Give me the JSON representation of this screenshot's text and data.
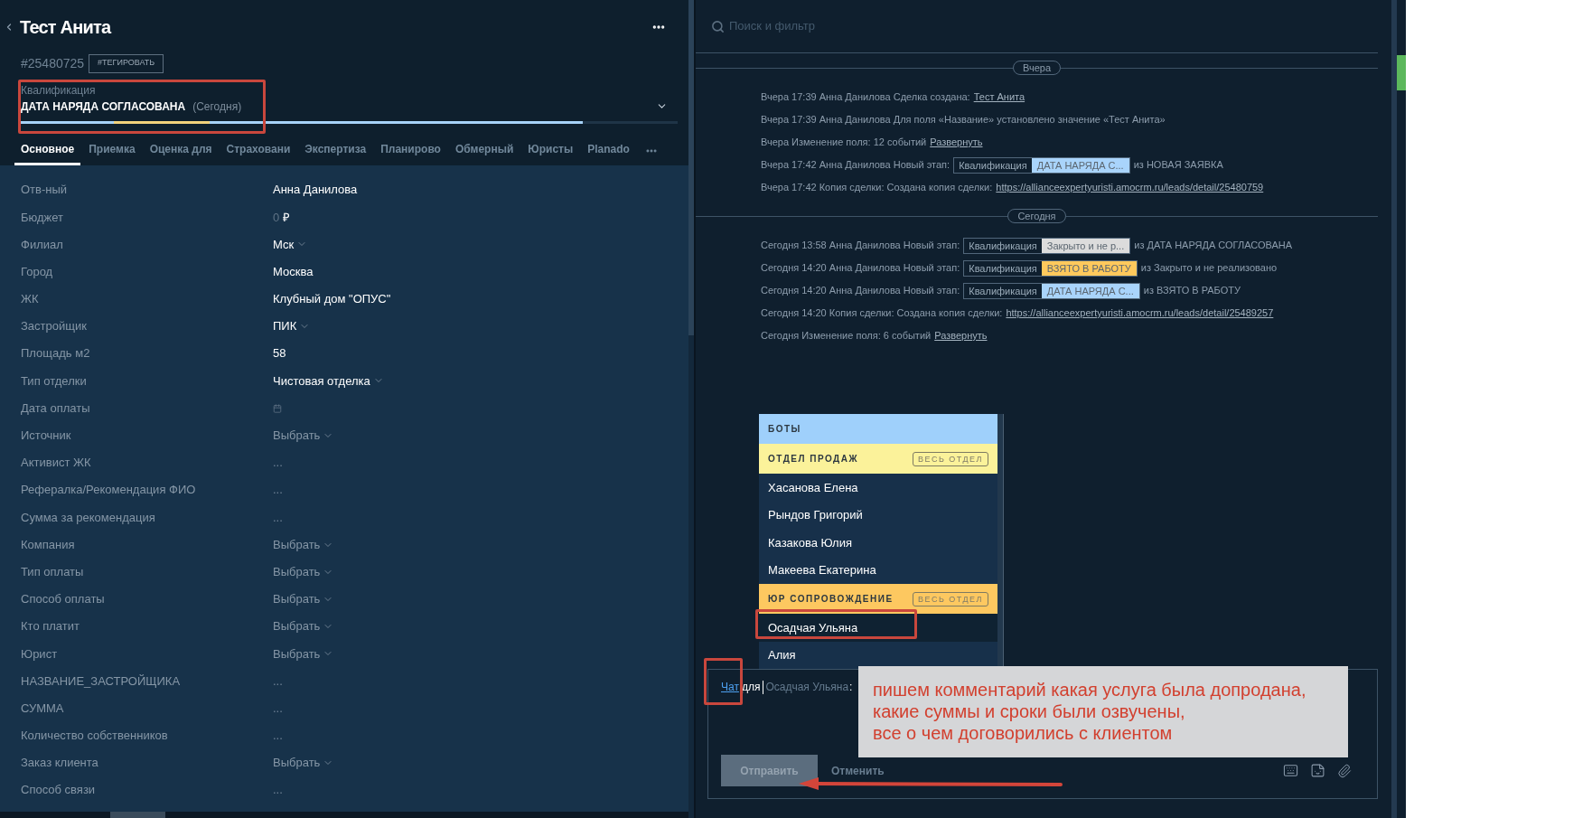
{
  "header": {
    "title": "Тест Анита",
    "deal_id": "#25480725",
    "tag_button": "#ТЕГИРОВАТЬ",
    "pipeline": "Квалификация",
    "stage": "ДАТА НАРЯДА СОГЛАСОВАНА",
    "stage_since": "(Сегодня)",
    "progress": [
      {
        "color": "#a6d2f7",
        "level": 0.142
      },
      {
        "color": "#f2d27c",
        "level": 0.288
      },
      {
        "color": "#a6d2f7",
        "level": 0.856
      }
    ]
  },
  "tabs": [
    {
      "label": "Основное",
      "selected": true
    },
    {
      "label": "Приемка",
      "selected": false
    },
    {
      "label": "Оценка для",
      "selected": false
    },
    {
      "label": "Страховани",
      "selected": false
    },
    {
      "label": "Экспертиза",
      "selected": false
    },
    {
      "label": "Планирово",
      "selected": false
    },
    {
      "label": "Обмерный",
      "selected": false
    },
    {
      "label": "Юристы",
      "selected": false
    },
    {
      "label": "Planado",
      "selected": false
    }
  ],
  "fields": [
    {
      "label": "Отв-ный",
      "kind": "text",
      "value": "Анна Данилова"
    },
    {
      "label": "Бюджет",
      "kind": "money",
      "placeholder": "0",
      "currency": "₽"
    },
    {
      "label": "Филиал",
      "kind": "select",
      "value": "Мск"
    },
    {
      "label": "Город",
      "kind": "text",
      "value": "Москва"
    },
    {
      "label": "ЖК",
      "kind": "text",
      "value": "Клубный дом \"ОПУС\""
    },
    {
      "label": "Застройщик",
      "kind": "select",
      "value": "ПИК"
    },
    {
      "label": "Площадь м2",
      "kind": "text",
      "value": "58"
    },
    {
      "label": "Тип отделки",
      "kind": "select",
      "value": "Чистовая отделка"
    },
    {
      "label": "Дата оплаты",
      "kind": "date"
    },
    {
      "label": "Источник",
      "kind": "select",
      "placeholder": "Выбрать"
    },
    {
      "label": "Активист ЖК",
      "kind": "text",
      "placeholder": "..."
    },
    {
      "label": "Рефералка/Рекомендация ФИО",
      "kind": "text",
      "placeholder": "..."
    },
    {
      "label": "Сумма за рекомендация",
      "kind": "text",
      "placeholder": "..."
    },
    {
      "label": "Компания",
      "kind": "select",
      "placeholder": "Выбрать"
    },
    {
      "label": "Тип оплаты",
      "kind": "select",
      "placeholder": "Выбрать"
    },
    {
      "label": "Способ оплаты",
      "kind": "select",
      "placeholder": "Выбрать"
    },
    {
      "label": "Кто платит",
      "kind": "select",
      "placeholder": "Выбрать"
    },
    {
      "label": "Юрист",
      "kind": "select",
      "placeholder": "Выбрать"
    },
    {
      "label": "НАЗВАНИЕ_ЗАСТРОЙЩИКА",
      "kind": "text",
      "placeholder": "..."
    },
    {
      "label": "СУММА",
      "kind": "text",
      "placeholder": "..."
    },
    {
      "label": "Количество собственников",
      "kind": "text",
      "placeholder": "..."
    },
    {
      "label": "Заказ клиента",
      "kind": "select",
      "placeholder": "Выбрать"
    },
    {
      "label": "Способ связи",
      "kind": "text",
      "placeholder": "..."
    }
  ],
  "search": {
    "placeholder": "Поиск и фильтр"
  },
  "timeline": [
    {
      "date": "Вчера",
      "events": [
        {
          "parts": [
            {
              "kind": "text",
              "text": "Вчера 17:39 Анна Данилова Сделка создана:"
            },
            {
              "kind": "link",
              "text": "Тест Анита"
            }
          ]
        },
        {
          "parts": [
            {
              "kind": "text",
              "text": "Вчера 17:39 Анна Данилова Для поля «Название» установлено значение «Тест Анита»"
            }
          ]
        },
        {
          "parts": [
            {
              "kind": "text",
              "text": "Вчера Изменение поля: 12 событий"
            },
            {
              "kind": "link",
              "text": "Развернуть"
            }
          ]
        },
        {
          "parts": [
            {
              "kind": "text",
              "text": "Вчера 17:42 Анна Данилова Новый этап:"
            },
            {
              "kind": "stage",
              "pipeline": "Квалификация",
              "status": "ДАТА НАРЯДА С...",
              "color": "#a9d4fb"
            },
            {
              "kind": "text",
              "text": "из НОВАЯ ЗАЯВКА"
            }
          ]
        },
        {
          "parts": [
            {
              "kind": "text",
              "text": "Вчера 17:42 Копия сделки: Создана копия сделки:"
            },
            {
              "kind": "link",
              "text": "https://allianceexpertyuristi.amocrm.ru/leads/detail/25480759"
            }
          ]
        }
      ]
    },
    {
      "date": "Сегодня",
      "events": [
        {
          "parts": [
            {
              "kind": "text",
              "text": "Сегодня 13:58 Анна Данилова Новый этап:"
            },
            {
              "kind": "stage",
              "pipeline": "Квалификация",
              "status": "Закрыто и не р...",
              "color": "#dcdcdc"
            },
            {
              "kind": "text",
              "text": "из ДАТА НАРЯДА СОГЛАСОВАНА"
            }
          ]
        },
        {
          "parts": [
            {
              "kind": "text",
              "text": "Сегодня 14:20 Анна Данилова Новый этап:"
            },
            {
              "kind": "stage",
              "pipeline": "Квалификация",
              "status": "ВЗЯТО В РАБОТУ",
              "color": "#ffc95c"
            },
            {
              "kind": "text",
              "text": "из Закрыто и не реализовано"
            }
          ]
        },
        {
          "parts": [
            {
              "kind": "text",
              "text": "Сегодня 14:20 Анна Данилова Новый этап:"
            },
            {
              "kind": "stage",
              "pipeline": "Квалификация",
              "status": "ДАТА НАРЯДА С...",
              "color": "#a9d4fb"
            },
            {
              "kind": "text",
              "text": "из ВЗЯТО В РАБОТУ"
            }
          ]
        },
        {
          "parts": [
            {
              "kind": "text",
              "text": "Сегодня 14:20 Копия сделки: Создана копия сделки:"
            },
            {
              "kind": "link",
              "text": "https://allianceexpertyuristi.amocrm.ru/leads/detail/25489257"
            }
          ]
        },
        {
          "parts": [
            {
              "kind": "text",
              "text": "Сегодня Изменение поля: 6 событий"
            },
            {
              "kind": "link",
              "text": "Развернуть"
            }
          ]
        }
      ]
    }
  ],
  "mention_menu": {
    "groups": [
      {
        "name": "БОТЫ",
        "color": "#9fd0fb"
      },
      {
        "name": "ОТДЕЛ ПРОДАЖ",
        "color": "#fbf29a",
        "action": "ВЕСЬ ОТДЕЛ",
        "members": [
          {
            "name": "Хасанова Елена",
            "selected": false
          },
          {
            "name": "Рындов Григорий",
            "selected": false
          },
          {
            "name": "Казакова Юлия",
            "selected": false
          },
          {
            "name": "Макеева Екатерина",
            "selected": false
          }
        ]
      },
      {
        "name": "ЮР СОПРОВОЖДЕНИЕ",
        "color": "#fdc860",
        "action": "ВЕСЬ ОТДЕЛ",
        "members": [
          {
            "name": "Осадчая Ульяна",
            "selected": true
          },
          {
            "name": "Алия",
            "selected": false
          }
        ]
      }
    ]
  },
  "composer": {
    "chat_link": "Чат",
    "for_label": "для",
    "recipient": "Осадчая Ульяна",
    "separator": ":",
    "send_button": {
      "label": "Отправить",
      "disabled": true
    },
    "cancel_button": "Отменить"
  },
  "annotation": {
    "lines": [
      "пишем комментарий какая услуга была допродана,",
      "какие суммы и сроки были озвучены,",
      "все о чем договорились с клиентом"
    ]
  }
}
